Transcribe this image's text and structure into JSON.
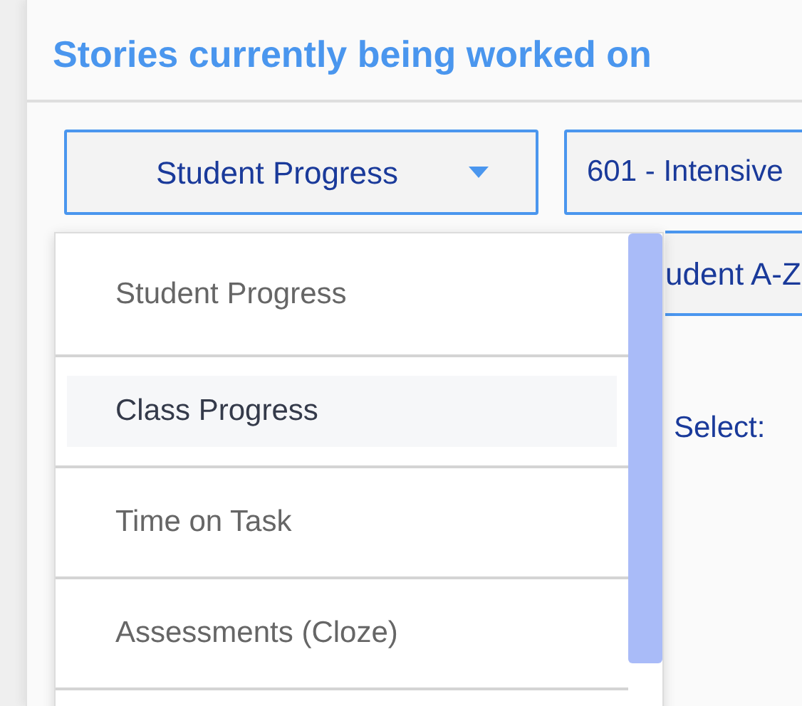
{
  "title": "Stories currently being worked on",
  "report_select": {
    "value": "Student Progress",
    "expanded": true
  },
  "class_select": {
    "value": "601 - Intensive"
  },
  "sort_button": {
    "label": "udent A-Z"
  },
  "select_label": "Select:",
  "menu_items": [
    {
      "label": "Student Progress",
      "highlighted": false
    },
    {
      "label": "Class Progress",
      "highlighted": true
    },
    {
      "label": "Time on Task",
      "highlighted": false
    },
    {
      "label": "Assessments (Cloze)",
      "highlighted": false
    }
  ]
}
